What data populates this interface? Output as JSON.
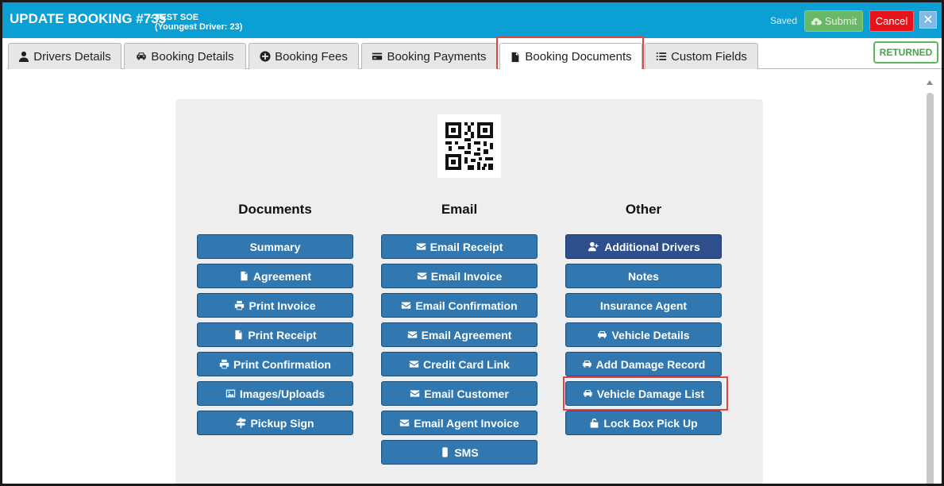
{
  "header": {
    "title": "UPDATE BOOKING #735",
    "customer": "- TEST SOE",
    "youngest_driver": "(Youngest Driver: 23)",
    "saved_label": "Saved",
    "submit_label": "Submit",
    "cancel_label": "Cancel",
    "close_glyph": "✕"
  },
  "status_badge": "RETURNED",
  "tabs": [
    {
      "label": "Drivers Details",
      "icon": "user-icon"
    },
    {
      "label": "Booking Details",
      "icon": "car-icon"
    },
    {
      "label": "Booking Fees",
      "icon": "plus-circle-icon"
    },
    {
      "label": "Booking Payments",
      "icon": "credit-card-icon"
    },
    {
      "label": "Booking Documents",
      "icon": "file-icon",
      "active": true
    },
    {
      "label": "Custom Fields",
      "icon": "list-icon"
    }
  ],
  "sections": {
    "documents": {
      "heading": "Documents",
      "buttons": [
        {
          "label": "Summary",
          "icon": ""
        },
        {
          "label": "Agreement",
          "icon": "file-icon"
        },
        {
          "label": "Print Invoice",
          "icon": "print-icon"
        },
        {
          "label": "Print Receipt",
          "icon": "file-icon"
        },
        {
          "label": "Print Confirmation",
          "icon": "print-icon"
        },
        {
          "label": "Images/Uploads",
          "icon": "image-icon"
        },
        {
          "label": "Pickup Sign",
          "icon": "signpost-icon"
        }
      ]
    },
    "email": {
      "heading": "Email",
      "buttons": [
        {
          "label": "Email Receipt",
          "icon": "envelope-icon"
        },
        {
          "label": "Email Invoice",
          "icon": "envelope-icon"
        },
        {
          "label": "Email Confirmation",
          "icon": "envelope-icon"
        },
        {
          "label": "Email Agreement",
          "icon": "envelope-icon"
        },
        {
          "label": "Credit Card Link",
          "icon": "envelope-icon"
        },
        {
          "label": "Email Customer",
          "icon": "envelope-icon"
        },
        {
          "label": "Email Agent Invoice",
          "icon": "envelope-icon"
        },
        {
          "label": "SMS",
          "icon": "mobile-icon"
        }
      ]
    },
    "other": {
      "heading": "Other",
      "buttons": [
        {
          "label": "Additional Drivers",
          "icon": "user-plus-icon"
        },
        {
          "label": "Notes",
          "icon": ""
        },
        {
          "label": "Insurance Agent",
          "icon": ""
        },
        {
          "label": "Vehicle Details",
          "icon": "car-icon"
        },
        {
          "label": "Add Damage Record",
          "icon": "car-icon"
        },
        {
          "label": "Vehicle Damage List",
          "icon": "car-icon"
        },
        {
          "label": "Lock Box Pick Up",
          "icon": "unlock-icon"
        }
      ]
    }
  },
  "colors": {
    "header_bg": "#0c9fd4",
    "action_button": "#3178b0",
    "highlight": "#e14646",
    "returned": "#4aa24a"
  }
}
